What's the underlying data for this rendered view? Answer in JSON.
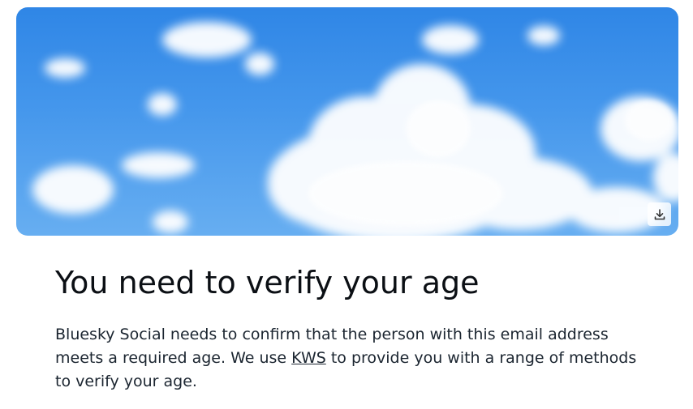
{
  "hero": {
    "download_icon": "download-icon"
  },
  "heading": {
    "title": "You need to verify your age"
  },
  "message": {
    "before_link": "Bluesky Social needs to confirm that the person with this email address meets a required age. We use ",
    "link_text": "KWS",
    "after_link": " to provide you with a range of methods to verify your age."
  },
  "colors": {
    "sky": "#3b8fe9",
    "text": "#0b0f14"
  }
}
